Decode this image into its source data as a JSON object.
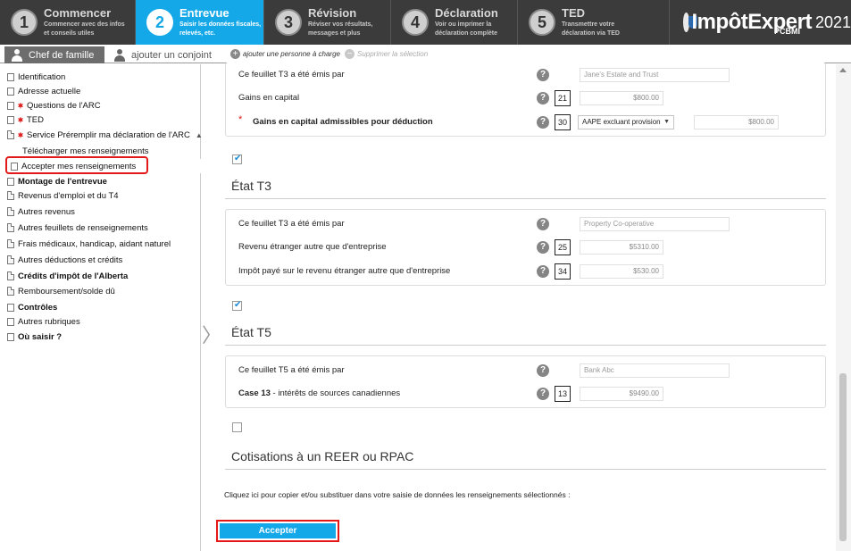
{
  "steps": [
    {
      "num": "1",
      "title": "Commencer",
      "sub1": "Commencer avec des infos",
      "sub2": "et conseils utiles",
      "active": false
    },
    {
      "num": "2",
      "title": "Entrevue",
      "sub1": "Saisir les données fiscales,",
      "sub2": "relevés, etc.",
      "active": true
    },
    {
      "num": "3",
      "title": "Révision",
      "sub1": "Réviser vos résultats,",
      "sub2": "messages et plus",
      "active": false
    },
    {
      "num": "4",
      "title": "Déclaration",
      "sub1": "Voir ou imprimer la",
      "sub2": "déclaration complète",
      "active": false
    },
    {
      "num": "5",
      "title": "TED",
      "sub1": "Transmettre votre",
      "sub2": "déclaration via TED",
      "active": false
    }
  ],
  "logo": {
    "brand": "ImpôtExpert",
    "sub": "PCBMI",
    "year": "2021"
  },
  "person_tabs": {
    "active": "Chef de famille",
    "inactive": "ajouter un conjoint"
  },
  "dependent_actions": {
    "add": "ajouter une personne à charge",
    "delete": "Supprimer la sélection"
  },
  "sidebar": {
    "items": [
      {
        "label": "Identification",
        "icon": "checkbox-icon"
      },
      {
        "label": "Adresse actuelle",
        "icon": "checkbox-icon"
      },
      {
        "label": "Questions de l'ARC",
        "icon": "maple-leaf-icon"
      },
      {
        "label": "TED",
        "icon": "maple-leaf-icon"
      },
      {
        "label": "Service Préremplir ma déclaration de l'ARC",
        "icon": "maple-leaf-icon"
      },
      {
        "label": "Télécharger mes renseignements",
        "icon": "none"
      },
      {
        "label": "Accepter mes renseignements",
        "icon": "checkbox-icon"
      },
      {
        "label": "Montage de l'entrevue",
        "icon": "checkbox-icon"
      },
      {
        "label": "Revenus d'emploi et du T4",
        "icon": "document-icon"
      },
      {
        "label": "Autres revenus",
        "icon": "document-icon"
      },
      {
        "label": "Autres feuillets de renseignements",
        "icon": "document-icon"
      },
      {
        "label": "Frais médicaux, handicap, aidant naturel",
        "icon": "document-icon"
      },
      {
        "label": "Autres déductions et crédits",
        "icon": "document-icon"
      },
      {
        "label": "Crédits d'impôt de l'Alberta",
        "icon": "document-icon"
      },
      {
        "label": "Remboursement/solde dû",
        "icon": "document-icon"
      },
      {
        "label": "Contrôles",
        "icon": "checkbox-icon"
      },
      {
        "label": "Autres rubriques",
        "icon": "checkbox-icon"
      },
      {
        "label": "Où saisir ?",
        "icon": "checkbox-icon"
      }
    ]
  },
  "card1": {
    "row1_label": "Ce feuillet T3 a été émis par",
    "row1_value": "Jane's Estate and Trust",
    "row2_label": "Gains en capital",
    "row2_box": "21",
    "row2_value": "$800.00",
    "row3_label": "Gains en capital admissibles pour déduction",
    "row3_box": "30",
    "row3_select": "AAPE excluant provision",
    "row3_value": "$800.00"
  },
  "sections": [
    {
      "title": "État T3",
      "checked": true
    },
    {
      "title": "État T5",
      "checked": true
    },
    {
      "title": "Cotisations à un REER ou RPAC",
      "checked": false
    }
  ],
  "card2": {
    "row1_label": "Ce feuillet T3 a été émis par",
    "row1_value": "Property Co-operative",
    "row2_label": "Revenu étranger autre que d'entreprise",
    "row2_box": "25",
    "row2_value": "$5310.00",
    "row3_label": "Impôt payé sur le revenu étranger autre que d'entreprise",
    "row3_box": "34",
    "row3_value": "$530.00"
  },
  "card3": {
    "row1_label": "Ce feuillet T5 a été émis par",
    "row1_value": "Bank Abc",
    "row2_label_bold": "Case 13",
    "row2_label_rest": " - intérêts de sources canadiennes",
    "row2_box": "13",
    "row2_value": "$9490.00"
  },
  "copy_text": "Cliquez ici pour copier et/ou substituer dans votre saisie de données les renseignements sélectionnés :",
  "accept_button": "Accepter",
  "help_glyph": "?",
  "colors": {
    "accent": "#14a8e8",
    "highlight": "#e31818",
    "topbar": "#3b3b3b"
  }
}
